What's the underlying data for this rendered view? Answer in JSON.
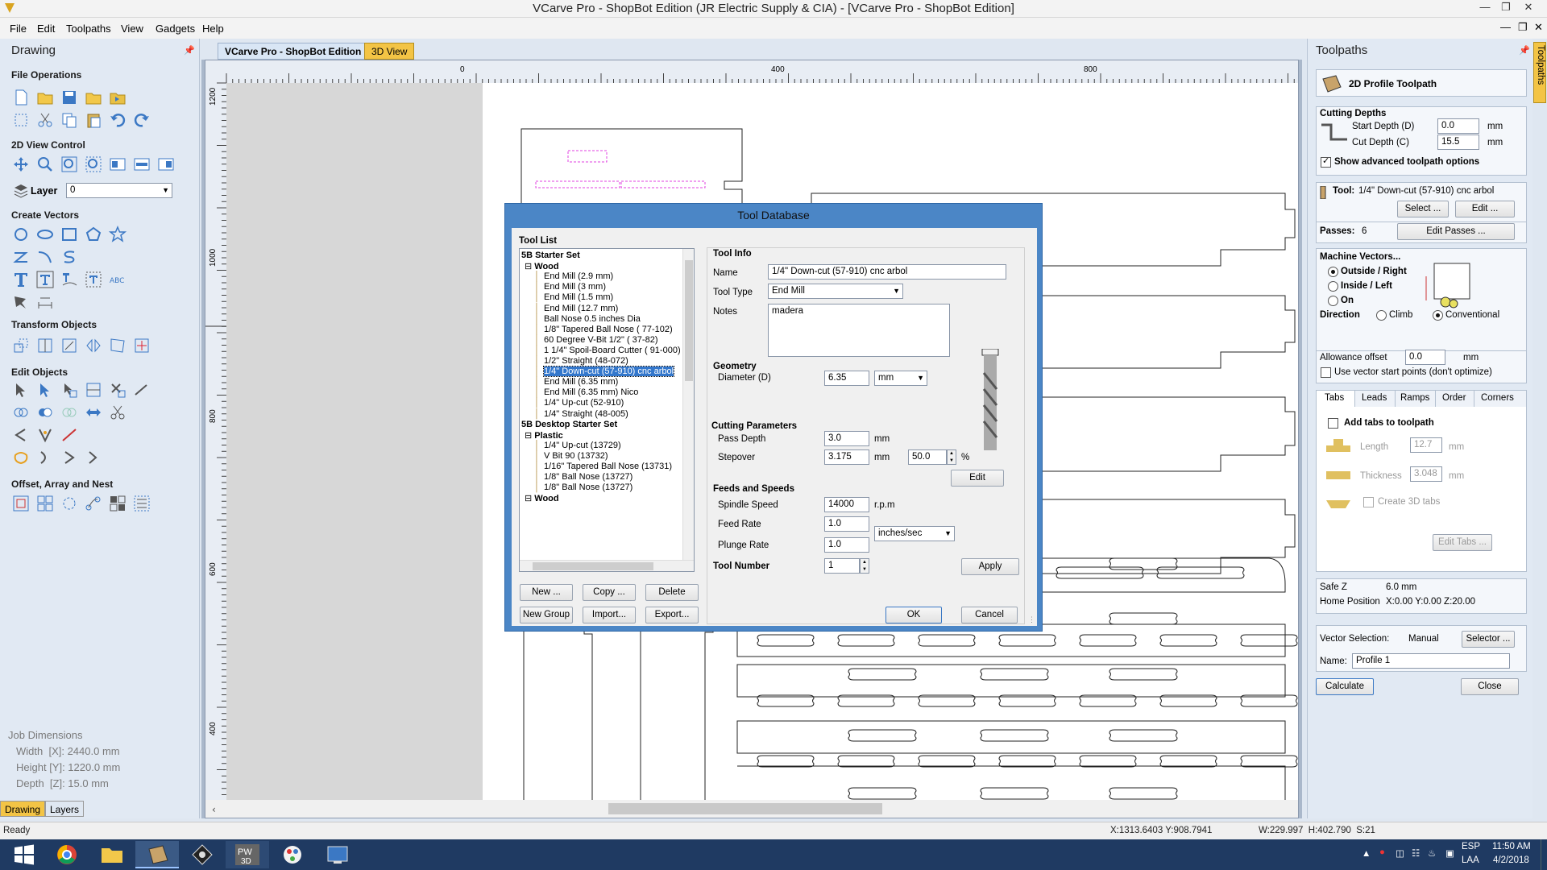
{
  "window": {
    "title": "VCarve Pro - ShopBot Edition (JR Electric Supply & CIA) - [VCarve Pro - ShopBot Edition]"
  },
  "menu": [
    "File",
    "Edit",
    "Toolpaths",
    "View",
    "Gadgets",
    "Help"
  ],
  "left_panel": {
    "title": "Drawing",
    "sections": {
      "file_ops": "File Operations",
      "view_control": "2D View Control",
      "create_vectors": "Create Vectors",
      "transform": "Transform Objects",
      "edit_objects": "Edit Objects",
      "offset": "Offset, Array and Nest"
    },
    "layer_label": "Layer",
    "layer_value": "0",
    "job": {
      "title": "Job Dimensions",
      "width": "Width  [X]: 2440.0 mm",
      "height": "Height [Y]: 1220.0 mm",
      "depth": "Depth  [Z]: 15.0 mm"
    },
    "tabs": [
      "Drawing",
      "Layers"
    ]
  },
  "doc_tabs": [
    "VCarve Pro - ShopBot Edition",
    "3D View"
  ],
  "ruler": {
    "h_labels": [
      "0",
      "400",
      "800"
    ],
    "v_labels": [
      "1200",
      "1000",
      "800",
      "600",
      "400"
    ]
  },
  "status": {
    "left": "Ready",
    "coords": "X:1313.6403 Y:908.7941",
    "size": "W:229.997  H:402.790  S:21"
  },
  "toolpath_panel": {
    "title": "Toolpaths",
    "vtab": "Toolpaths",
    "heading": "2D Profile Toolpath",
    "cutting_depths": "Cutting Depths",
    "start_depth_label": "Start Depth (D)",
    "start_depth": "0.0",
    "cut_depth_label": "Cut Depth (C)",
    "cut_depth": "15.5",
    "unit": "mm",
    "advanced": "Show advanced toolpath options",
    "tool_label": "Tool:",
    "tool_name": "1/4\" Down-cut (57-910) cnc arbol",
    "select_btn": "Select ...",
    "edit_btn": "Edit ...",
    "passes_label": "Passes:",
    "passes": "6",
    "edit_passes": "Edit Passes ...",
    "machine_vectors": "Machine Vectors...",
    "outside": "Outside / Right",
    "inside": "Inside / Left",
    "on": "On",
    "direction": "Direction",
    "climb": "Climb",
    "conventional": "Conventional",
    "allowance_label": "Allowance offset",
    "allowance": "0.0",
    "vector_start": "Use vector start points (don't optimize)",
    "tabs": [
      "Tabs",
      "Leads",
      "Ramps",
      "Order",
      "Corners"
    ],
    "add_tabs": "Add tabs to toolpath",
    "length_label": "Length",
    "length": "12.7",
    "thickness_label": "Thickness",
    "thickness": "3.048",
    "create3d": "Create 3D tabs",
    "edit_tabs": "Edit Tabs ...",
    "safe_z_label": "Safe Z",
    "safe_z": "6.0 mm",
    "home_label": "Home Position",
    "home": "X:0.00 Y:0.00 Z:20.00",
    "vector_sel_label": "Vector Selection:",
    "vector_sel": "Manual",
    "selector_btn": "Selector ...",
    "name_label": "Name:",
    "name": "Profile 1",
    "calculate": "Calculate",
    "close": "Close"
  },
  "dialog": {
    "title": "Tool Database",
    "tool_list": "Tool List",
    "tree": [
      {
        "t": "5B Starter Set",
        "g": 1,
        "l": 0
      },
      {
        "t": "Wood",
        "g": 1,
        "l": 1
      },
      {
        "t": "End Mill (2.9 mm)",
        "l": 2
      },
      {
        "t": "End Mill (3 mm)",
        "l": 2
      },
      {
        "t": "End Mill (1.5 mm)",
        "l": 2
      },
      {
        "t": "End Mill (12.7 mm)",
        "l": 2
      },
      {
        "t": "Ball Nose 0.5 inches Dia",
        "l": 2
      },
      {
        "t": "1/8\" Tapered Ball Nose ( 77-102)",
        "l": 2
      },
      {
        "t": "60 Degree V-Bit 1/2\"  ( 37-82)",
        "l": 2
      },
      {
        "t": "1 1/4\" Spoil-Board Cutter ( 91-000)",
        "l": 2
      },
      {
        "t": "1/2\" Straight  (48-072)",
        "l": 2
      },
      {
        "t": "1/4\"  Down-cut (57-910) cnc arbol",
        "l": 2,
        "sel": 1
      },
      {
        "t": "End Mill (6.35 mm)",
        "l": 2
      },
      {
        "t": "End Mill (6.35 mm) Nico",
        "l": 2
      },
      {
        "t": "1/4\" Up-cut (52-910)",
        "l": 2
      },
      {
        "t": "1/4\" Straight  (48-005)",
        "l": 2
      },
      {
        "t": "5B Desktop Starter Set",
        "g": 1,
        "l": 0
      },
      {
        "t": "Plastic",
        "g": 1,
        "l": 1
      },
      {
        "t": "1/4\" Up-cut (13729)",
        "l": 2
      },
      {
        "t": "V Bit 90 (13732)",
        "l": 2
      },
      {
        "t": "1/16\" Tapered Ball Nose (13731)",
        "l": 2
      },
      {
        "t": "1/8\" Ball Nose (13727)",
        "l": 2
      },
      {
        "t": "1/8\" Ball Nose (13727)",
        "l": 2
      },
      {
        "t": "Wood",
        "g": 1,
        "l": 1
      }
    ],
    "btns": {
      "new": "New ...",
      "copy": "Copy ...",
      "delete": "Delete",
      "new_group": "New Group",
      "import": "Import...",
      "export": "Export..."
    },
    "tool_info": "Tool Info",
    "name_label": "Name",
    "name": "1/4\"  Down-cut (57-910) cnc arbol",
    "type_label": "Tool Type",
    "type": "End Mill",
    "notes_label": "Notes",
    "notes": "madera",
    "geometry": "Geometry",
    "diameter_label": "Diameter (D)",
    "diameter": "6.35",
    "diameter_unit": "mm",
    "cutting_params": "Cutting Parameters",
    "pass_depth_label": "Pass Depth",
    "pass_depth": "3.0",
    "pass_unit": "mm",
    "stepover_label": "Stepover",
    "stepover": "3.175",
    "stepover_unit": "mm",
    "stepover_pct": "50.0",
    "pct": "%",
    "edit": "Edit",
    "feeds": "Feeds and Speeds",
    "spindle_label": "Spindle Speed",
    "spindle": "14000",
    "rpm": "r.p.m",
    "feed_label": "Feed Rate",
    "feed": "1.0",
    "plunge_label": "Plunge Rate",
    "plunge": "1.0",
    "rate_unit": "inches/sec",
    "toolnum_label": "Tool Number",
    "toolnum": "1",
    "apply": "Apply",
    "ok": "OK",
    "cancel": "Cancel"
  },
  "taskbar": {
    "lang1": "ESP",
    "lang2": "LAA",
    "time": "11:50 AM",
    "date": "4/2/2018"
  }
}
